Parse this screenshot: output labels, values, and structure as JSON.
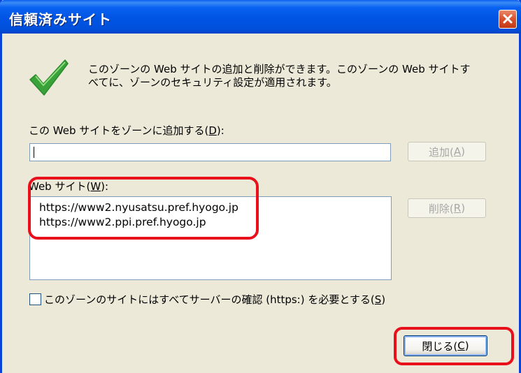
{
  "window": {
    "title": "信頼済みサイト",
    "close_icon": "close-icon"
  },
  "description": {
    "icon": "checkmark-icon",
    "line1": "このゾーンの Web サイトの追加と削除ができます。このゾーンの Web サイトす",
    "line2": "べてに、ゾーンのセキュリティ設定が適用されます。"
  },
  "add_site": {
    "label_prefix": "この Web サイトをゾーンに追加する(",
    "label_accel": "D",
    "label_suffix": "):",
    "input_value": "",
    "button_prefix": "追加(",
    "button_accel": "A",
    "button_suffix": ")"
  },
  "sites": {
    "label_prefix": "Web サイト(",
    "label_accel": "W",
    "label_suffix": "):",
    "items": [
      "https://www2.nyusatsu.pref.hyogo.jp",
      "https://www2.ppi.pref.hyogo.jp"
    ],
    "remove_prefix": "削除(",
    "remove_accel": "R",
    "remove_suffix": ")"
  },
  "require_https": {
    "checked": false,
    "label_prefix": "このゾーンのサイトにはすべてサーバーの確認 (https:) を必要とする(",
    "label_accel": "S",
    "label_suffix": ")"
  },
  "footer": {
    "close_prefix": "閉じる(",
    "close_accel": "C",
    "close_suffix": ")"
  },
  "colors": {
    "titlebar": "#0054e3",
    "dialog_bg": "#ece9d8",
    "highlight": "#e8101a",
    "check_green": "#3aa23a"
  }
}
